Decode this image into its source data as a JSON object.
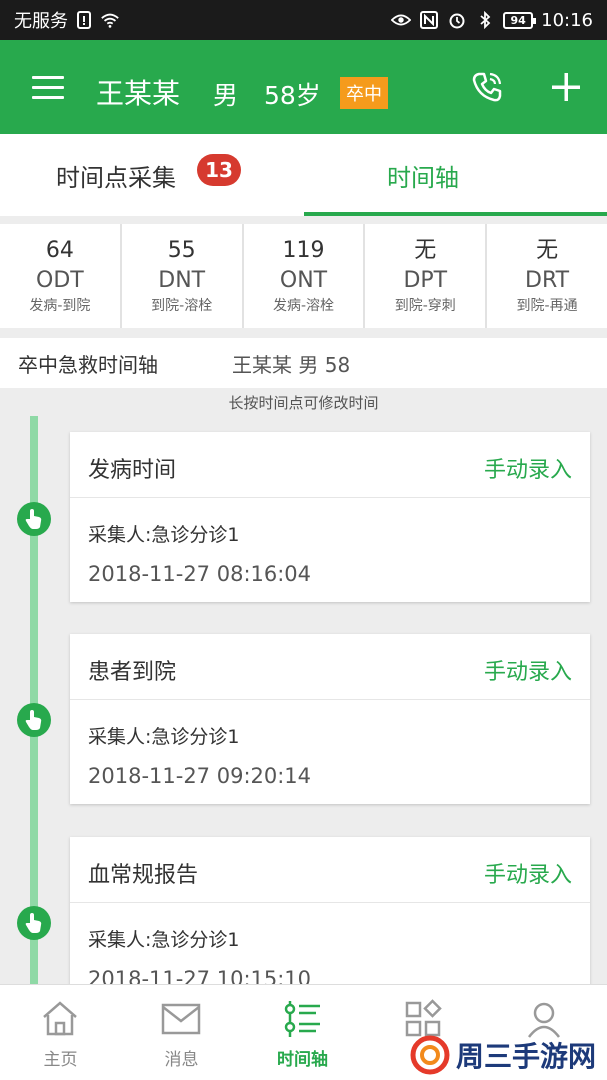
{
  "status_bar": {
    "carrier": "无服务",
    "battery": "94",
    "time": "10:16"
  },
  "header": {
    "patient_name": "王某某",
    "patient_sex": "男",
    "patient_age": "58岁",
    "badge": "卒中",
    "brand_color": "#28a94d"
  },
  "tabs": [
    {
      "label": "时间点采集",
      "badge": "13"
    },
    {
      "label": "时间轴"
    }
  ],
  "metrics": [
    {
      "value": "64",
      "code": "ODT",
      "desc": "发病-到院"
    },
    {
      "value": "55",
      "code": "DNT",
      "desc": "到院-溶栓"
    },
    {
      "value": "119",
      "code": "ONT",
      "desc": "发病-溶栓"
    },
    {
      "value": "无",
      "code": "DPT",
      "desc": "到院-穿刺"
    },
    {
      "value": "无",
      "code": "DRT",
      "desc": "到院-再通"
    }
  ],
  "section": {
    "title": "卒中急救时间轴",
    "patient": "王某某 男 58",
    "hint": "长按时间点可修改时间"
  },
  "events": [
    {
      "title": "发病时间",
      "action": "手动录入",
      "collector": "采集人:急诊分诊1",
      "time": "2018-11-27 08:16:04"
    },
    {
      "title": "患者到院",
      "action": "手动录入",
      "collector": "采集人:急诊分诊1",
      "time": "2018-11-27 09:20:14"
    },
    {
      "title": "血常规报告",
      "action": "手动录入",
      "collector": "采集人:急诊分诊1",
      "time": "2018-11-27 10:15:10"
    }
  ],
  "bottom_nav": [
    {
      "label": "主页",
      "icon": "home-icon"
    },
    {
      "label": "消息",
      "icon": "mail-icon"
    },
    {
      "label": "时间轴",
      "icon": "timeline-list-icon",
      "active": true
    },
    {
      "label": "",
      "icon": "apps-icon"
    },
    {
      "label": "",
      "icon": "user-icon"
    }
  ],
  "watermark": {
    "text": "周三手游网"
  }
}
